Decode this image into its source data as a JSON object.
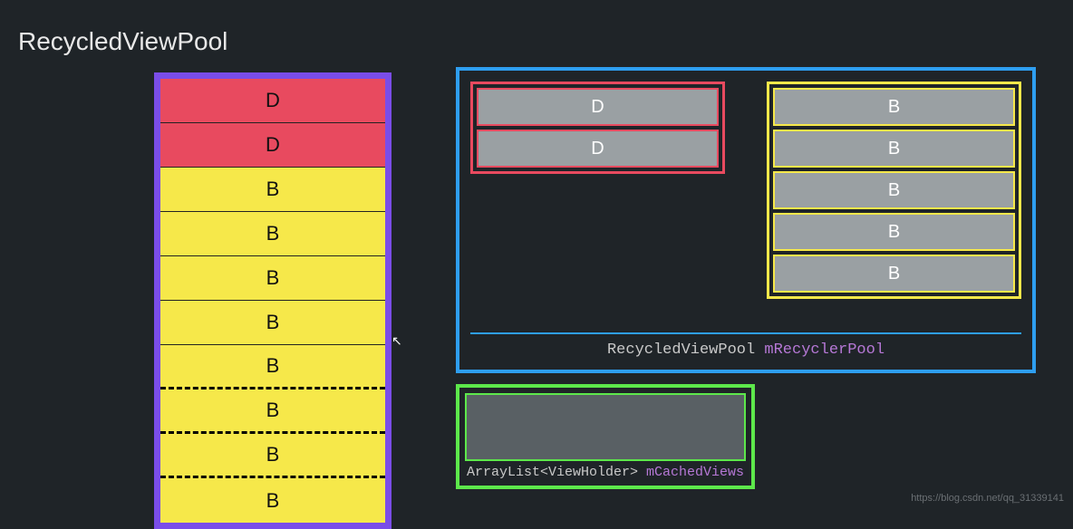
{
  "title": "RecycledViewPool",
  "left_stack": {
    "rows": [
      {
        "label": "D",
        "type": "d",
        "border": "solid"
      },
      {
        "label": "D",
        "type": "d",
        "border": "solid"
      },
      {
        "label": "B",
        "type": "b",
        "border": "solid"
      },
      {
        "label": "B",
        "type": "b",
        "border": "solid"
      },
      {
        "label": "B",
        "type": "b",
        "border": "solid"
      },
      {
        "label": "B",
        "type": "b",
        "border": "solid"
      },
      {
        "label": "B",
        "type": "b",
        "border": "dashed"
      },
      {
        "label": "B",
        "type": "b",
        "border": "dashed"
      },
      {
        "label": "B",
        "type": "b",
        "border": "dashed"
      },
      {
        "label": "B",
        "type": "b",
        "border": "last"
      }
    ]
  },
  "pool": {
    "d_items": [
      {
        "label": "D"
      },
      {
        "label": "D"
      }
    ],
    "b_items": [
      {
        "label": "B"
      },
      {
        "label": "B"
      },
      {
        "label": "B"
      },
      {
        "label": "B"
      },
      {
        "label": "B"
      }
    ],
    "label_type": "RecycledViewPool",
    "label_var": "mRecyclerPool"
  },
  "cached": {
    "label_type": "ArrayList<ViewHolder>",
    "label_var": "mCachedViews"
  },
  "watermark": "https://blog.csdn.net/qq_31339141",
  "colors": {
    "background": "#1f2428",
    "purple": "#7a4de8",
    "red": "#e84a5f",
    "yellow": "#f6e84a",
    "blue": "#2e9ef0",
    "green": "#5de84b",
    "grey": "#9aa0a3"
  }
}
